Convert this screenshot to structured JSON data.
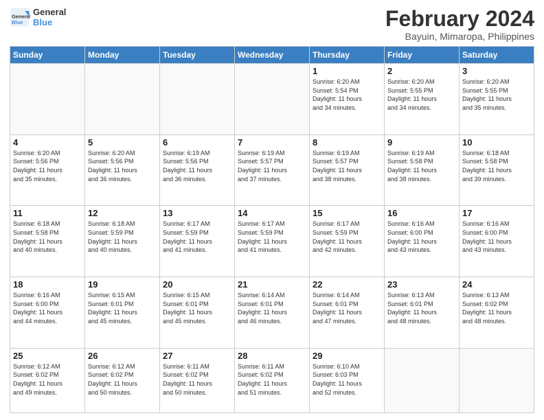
{
  "header": {
    "logo_general": "General",
    "logo_blue": "Blue",
    "month_year": "February 2024",
    "location": "Bayuin, Mimaropa, Philippines"
  },
  "days_of_week": [
    "Sunday",
    "Monday",
    "Tuesday",
    "Wednesday",
    "Thursday",
    "Friday",
    "Saturday"
  ],
  "weeks": [
    [
      {
        "day": "",
        "info": ""
      },
      {
        "day": "",
        "info": ""
      },
      {
        "day": "",
        "info": ""
      },
      {
        "day": "",
        "info": ""
      },
      {
        "day": "1",
        "info": "Sunrise: 6:20 AM\nSunset: 5:54 PM\nDaylight: 11 hours\nand 34 minutes."
      },
      {
        "day": "2",
        "info": "Sunrise: 6:20 AM\nSunset: 5:55 PM\nDaylight: 11 hours\nand 34 minutes."
      },
      {
        "day": "3",
        "info": "Sunrise: 6:20 AM\nSunset: 5:55 PM\nDaylight: 11 hours\nand 35 minutes."
      }
    ],
    [
      {
        "day": "4",
        "info": "Sunrise: 6:20 AM\nSunset: 5:56 PM\nDaylight: 11 hours\nand 35 minutes."
      },
      {
        "day": "5",
        "info": "Sunrise: 6:20 AM\nSunset: 5:56 PM\nDaylight: 11 hours\nand 36 minutes."
      },
      {
        "day": "6",
        "info": "Sunrise: 6:19 AM\nSunset: 5:56 PM\nDaylight: 11 hours\nand 36 minutes."
      },
      {
        "day": "7",
        "info": "Sunrise: 6:19 AM\nSunset: 5:57 PM\nDaylight: 11 hours\nand 37 minutes."
      },
      {
        "day": "8",
        "info": "Sunrise: 6:19 AM\nSunset: 5:57 PM\nDaylight: 11 hours\nand 38 minutes."
      },
      {
        "day": "9",
        "info": "Sunrise: 6:19 AM\nSunset: 5:58 PM\nDaylight: 11 hours\nand 38 minutes."
      },
      {
        "day": "10",
        "info": "Sunrise: 6:18 AM\nSunset: 5:58 PM\nDaylight: 11 hours\nand 39 minutes."
      }
    ],
    [
      {
        "day": "11",
        "info": "Sunrise: 6:18 AM\nSunset: 5:58 PM\nDaylight: 11 hours\nand 40 minutes."
      },
      {
        "day": "12",
        "info": "Sunrise: 6:18 AM\nSunset: 5:59 PM\nDaylight: 11 hours\nand 40 minutes."
      },
      {
        "day": "13",
        "info": "Sunrise: 6:17 AM\nSunset: 5:59 PM\nDaylight: 11 hours\nand 41 minutes."
      },
      {
        "day": "14",
        "info": "Sunrise: 6:17 AM\nSunset: 5:59 PM\nDaylight: 11 hours\nand 41 minutes."
      },
      {
        "day": "15",
        "info": "Sunrise: 6:17 AM\nSunset: 5:59 PM\nDaylight: 11 hours\nand 42 minutes."
      },
      {
        "day": "16",
        "info": "Sunrise: 6:16 AM\nSunset: 6:00 PM\nDaylight: 11 hours\nand 43 minutes."
      },
      {
        "day": "17",
        "info": "Sunrise: 6:16 AM\nSunset: 6:00 PM\nDaylight: 11 hours\nand 43 minutes."
      }
    ],
    [
      {
        "day": "18",
        "info": "Sunrise: 6:16 AM\nSunset: 6:00 PM\nDaylight: 11 hours\nand 44 minutes."
      },
      {
        "day": "19",
        "info": "Sunrise: 6:15 AM\nSunset: 6:01 PM\nDaylight: 11 hours\nand 45 minutes."
      },
      {
        "day": "20",
        "info": "Sunrise: 6:15 AM\nSunset: 6:01 PM\nDaylight: 11 hours\nand 45 minutes."
      },
      {
        "day": "21",
        "info": "Sunrise: 6:14 AM\nSunset: 6:01 PM\nDaylight: 11 hours\nand 46 minutes."
      },
      {
        "day": "22",
        "info": "Sunrise: 6:14 AM\nSunset: 6:01 PM\nDaylight: 11 hours\nand 47 minutes."
      },
      {
        "day": "23",
        "info": "Sunrise: 6:13 AM\nSunset: 6:01 PM\nDaylight: 11 hours\nand 48 minutes."
      },
      {
        "day": "24",
        "info": "Sunrise: 6:13 AM\nSunset: 6:02 PM\nDaylight: 11 hours\nand 48 minutes."
      }
    ],
    [
      {
        "day": "25",
        "info": "Sunrise: 6:12 AM\nSunset: 6:02 PM\nDaylight: 11 hours\nand 49 minutes."
      },
      {
        "day": "26",
        "info": "Sunrise: 6:12 AM\nSunset: 6:02 PM\nDaylight: 11 hours\nand 50 minutes."
      },
      {
        "day": "27",
        "info": "Sunrise: 6:11 AM\nSunset: 6:02 PM\nDaylight: 11 hours\nand 50 minutes."
      },
      {
        "day": "28",
        "info": "Sunrise: 6:11 AM\nSunset: 6:02 PM\nDaylight: 11 hours\nand 51 minutes."
      },
      {
        "day": "29",
        "info": "Sunrise: 6:10 AM\nSunset: 6:03 PM\nDaylight: 11 hours\nand 52 minutes."
      },
      {
        "day": "",
        "info": ""
      },
      {
        "day": "",
        "info": ""
      }
    ]
  ]
}
